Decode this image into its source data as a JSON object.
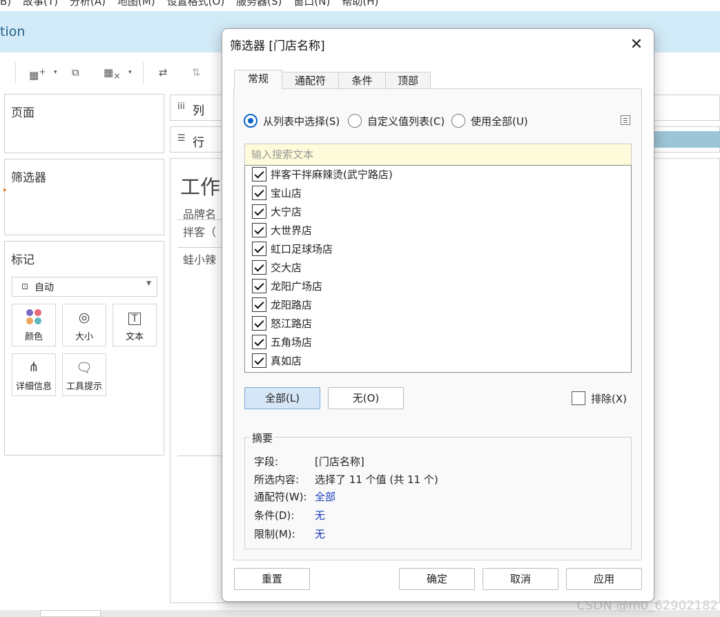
{
  "background": {
    "menubar": [
      "B)",
      "故事(T)",
      "分析(A)",
      "地图(M)",
      "设置格式(O)",
      "服务器(S)",
      "窗口(N)",
      "帮助(H)"
    ],
    "title_fragment": "tion",
    "pages_label": "页面",
    "filters_label": "筛选器",
    "marks_label": "标记",
    "marks_type": "自动",
    "mark_buttons": [
      {
        "label": "颜色",
        "icon": "color-dots-icon"
      },
      {
        "label": "大小",
        "icon": "size-icon"
      },
      {
        "label": "文本",
        "icon": "text-icon"
      },
      {
        "label": "详细信息",
        "icon": "detail-icon"
      },
      {
        "label": "工具提示",
        "icon": "tooltip-icon"
      }
    ],
    "columns_label": "列",
    "rows_label": "行",
    "sheet_title_fragment": "工作",
    "sheet_header_fragment": "品牌名",
    "sheet_row1_fragment": "拌客（",
    "sheet_row2_fragment": "蛙小辣",
    "watermark": "CSDN @m0_62902182"
  },
  "dialog": {
    "title": "筛选器 [门店名称]",
    "close_glyph": "✕",
    "tabs": [
      "常规",
      "通配符",
      "条件",
      "顶部"
    ],
    "active_tab": 0,
    "radio_options": [
      "从列表中选择(S)",
      "自定义值列表(C)",
      "使用全部(U)"
    ],
    "selected_radio": 0,
    "search_placeholder": "输入搜索文本",
    "items": [
      {
        "label": "拌客干拌麻辣烫(武宁路店)",
        "checked": true
      },
      {
        "label": "宝山店",
        "checked": true
      },
      {
        "label": "大宁店",
        "checked": true
      },
      {
        "label": "大世界店",
        "checked": true
      },
      {
        "label": "虹口足球场店",
        "checked": true
      },
      {
        "label": "交大店",
        "checked": true
      },
      {
        "label": "龙阳广场店",
        "checked": true
      },
      {
        "label": "龙阳路店",
        "checked": true
      },
      {
        "label": "怒江路店",
        "checked": true
      },
      {
        "label": "五角场店",
        "checked": true
      },
      {
        "label": "真如店",
        "checked": true
      }
    ],
    "all_button": "全部(L)",
    "none_button": "无(O)",
    "exclude_label": "排除(X)",
    "exclude_checked": false,
    "summary": {
      "title": "摘要",
      "rows": [
        {
          "label": "字段:",
          "value": "[门店名称]",
          "link": false
        },
        {
          "label": "所选内容:",
          "value": "选择了 11 个值 (共 11 个)",
          "link": false
        },
        {
          "label": "通配符(W):",
          "value": "全部",
          "link": true
        },
        {
          "label": "条件(D):",
          "value": "无",
          "link": true
        },
        {
          "label": "限制(M):",
          "value": "无",
          "link": true
        }
      ]
    },
    "footer": {
      "reset": "重置",
      "ok": "确定",
      "cancel": "取消",
      "apply": "应用"
    }
  }
}
